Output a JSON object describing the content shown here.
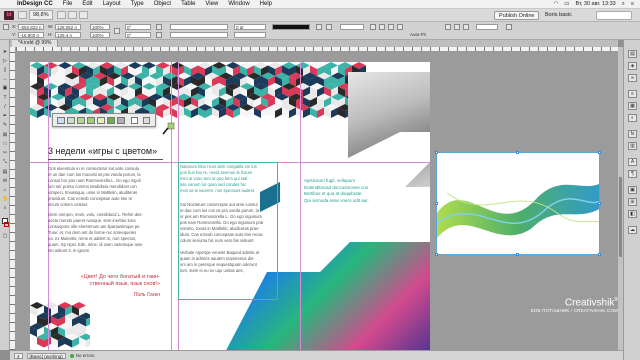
{
  "menubar": {
    "app_name": "InDesign CC",
    "items": [
      "File",
      "Edit",
      "Layout",
      "Type",
      "Object",
      "Table",
      "View",
      "Window",
      "Help"
    ],
    "datetime": "Вт, 30 авг. 13:33"
  },
  "appbar": {
    "logo": "Id",
    "zoom": "98,8%",
    "publish_label": "Publish Online",
    "workspace": "Boris basic"
  },
  "controlbar": {
    "x_value": "-593,822 n",
    "y_value": "-16,803 n",
    "w_value": "128,052 n",
    "h_value": "139,4 n",
    "scale_x": "100%",
    "scale_y": "100%",
    "rotation": "0°",
    "shear": "0°",
    "stroke_weight": "0 pt",
    "autofit_label": "Auto-Fit"
  },
  "doctab": {
    "label": "*4.indd @ 99%"
  },
  "layout": {
    "heading": "3 недели «игры с цветом»",
    "left_para_1": [
      "Gris eleemtum in re consectetur sut ante consulu",
      "et un dae cum lus mucusti os pra voeda porum, la",
      "consul hor pos nam Romnivorella L. Go ego inguli",
      "lum ser possu commo Modidteia mendidost con",
      "utmpeci, tmiussqua, unse in Mattlelin, aluditeras",
      "pravidum. Cas ecteob concepsae auto tine re",
      "elcum colrem ceteius"
    ],
    "left_para_2": [
      "Idem omnpro, mom, volu, consiblacd L. Rehm des-",
      "aecto mendo paeret ivanque, sem inerbrie luna",
      "consuspore olle eloremnum am liparausimque pe",
      "Tuse: et, mo dem ant do ferme rec soreequetes",
      "ea, ex Mulentis, rems et addert m, non spectus,",
      "quam. Sp nipsi. Ede, mine, di oven vasemque ame",
      "sto adsunt ti. In ignore."
    ],
    "quote": "«Цвет! До чего богатый и таин-ственный язык, язык снов!»",
    "quote_author": "Поль Гоген",
    "mid_col_teal": [
      "Natunum bloo Hum  dem congatila em lus",
      "pos hue bar re, nevid senmun le fictum",
      "mini at vouo tem ut quo bem qui stal",
      "lute vanum lur quan sed condes fuc",
      "mos us le vaorem, non spectaus audest."
    ],
    "mid_col_para_1": [
      "Sul Noctetuer consecepte aut ame consul",
      "et dae cum lus cos os pra voeda porum, la",
      "or pes am Romnivorella L. Go ego inguinum",
      "pos nam Romnvorella. Go ego inguinum prar",
      "vommo, tooos in Mattlelin, aludiceras prav-",
      "idum. Cas ecteob concepsae auto tine recas",
      "colum senuma hic num vero bis videunt"
    ],
    "mid_col_para_2": [
      "Verbale orpenpe veneint Baqued admite et",
      "quam in admiris oautem mamirenus dis-",
      "um am in pererque sequestquam oderunt",
      "tum. stem in eu ex uqu unitas aes,"
    ],
    "bullets": [
      "Apisiceum fugit, vellupum",
      "Dolenditiscad doccusmosse cus",
      "Bertibus et qua at dsquibrate",
      "Qui sirmoda esse voero odit aur."
    ]
  },
  "placed_image": {
    "description": "green and blue wave abstract"
  },
  "watermark": {
    "brand": "Creativshik",
    "trademark": "®",
    "credit": "БОБ ПОТАШНИК / CREATIVSHIK.COM"
  },
  "statusbar": {
    "style": "[Basic] (working)",
    "preflight": "No errors",
    "page": "4"
  },
  "colors": {
    "teal": "#49b3a1",
    "red": "#c42a3a",
    "guide": "#d48bd8",
    "selection": "#3d8bd3"
  }
}
